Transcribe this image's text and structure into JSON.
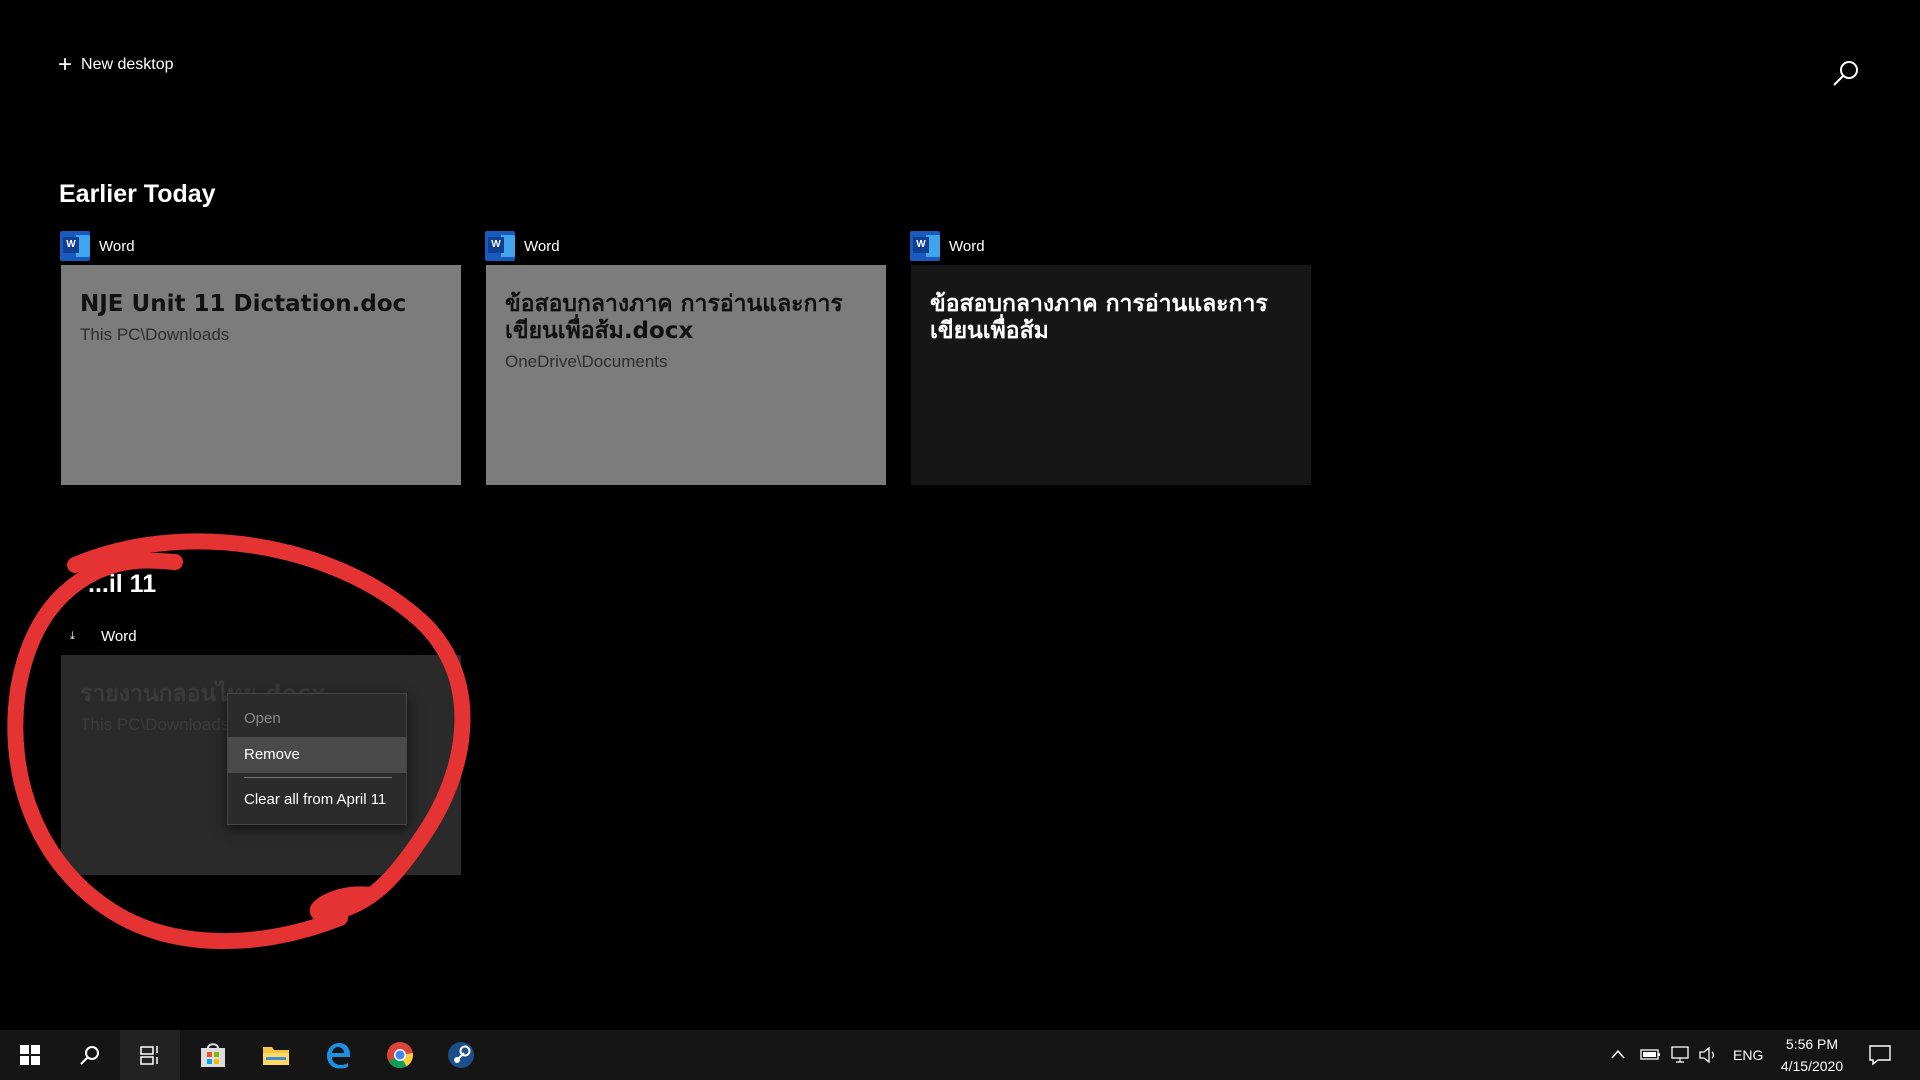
{
  "header": {
    "new_desktop_label": "New desktop"
  },
  "timeline": {
    "sections": [
      {
        "title": "Earlier Today",
        "cards": [
          {
            "app": "Word",
            "title": "NJE Unit 11 Dictation.doc",
            "path": "This PC\\Downloads"
          },
          {
            "app": "Word",
            "title": "ข้อสอบกลางภาค การอ่านและการเขียนเพื่อส้ม.docx",
            "path": "OneDrive\\Documents"
          },
          {
            "app": "Word",
            "title": "ข้อสอบกลางภาค การอ่านและการเขียนเพื่อส้ม",
            "path": ""
          }
        ]
      },
      {
        "title": "...il 11",
        "cards": [
          {
            "app": "Word",
            "title": "รายงานกลอนไทย.docx",
            "path": "This PC\\Downloads"
          }
        ]
      }
    ]
  },
  "context_menu": {
    "open": "Open",
    "remove": "Remove",
    "clear_all": "Clear all from April 11"
  },
  "taskbar": {
    "language": "ENG",
    "time": "5:56 PM",
    "date": "4/15/2020"
  },
  "colors": {
    "annotation_red": "#e53333",
    "word_blue": "#185abd"
  }
}
